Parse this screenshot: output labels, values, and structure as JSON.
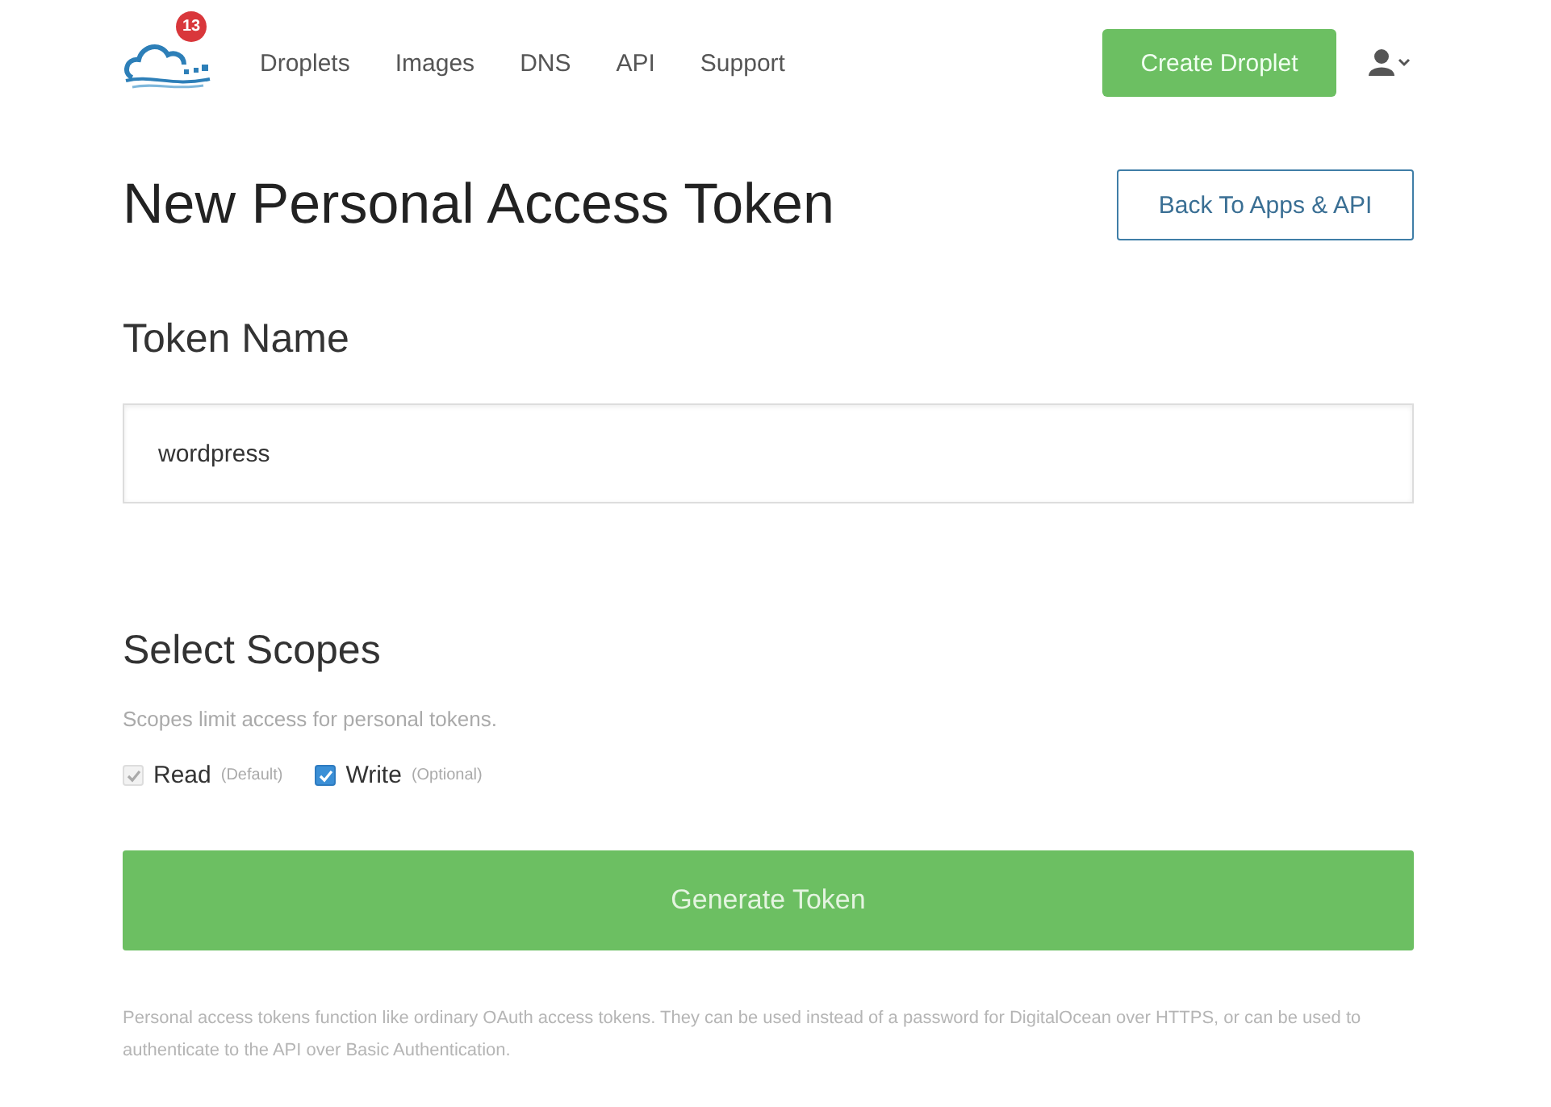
{
  "nav": {
    "badge": "13",
    "links": [
      {
        "label": "Droplets"
      },
      {
        "label": "Images"
      },
      {
        "label": "DNS"
      },
      {
        "label": "API"
      },
      {
        "label": "Support"
      }
    ],
    "create_button": "Create Droplet"
  },
  "page": {
    "title": "New Personal Access Token",
    "back_button": "Back To Apps & API"
  },
  "token_name": {
    "heading": "Token Name",
    "value": "wordpress"
  },
  "scopes": {
    "heading": "Select Scopes",
    "description": "Scopes limit access for personal tokens.",
    "options": [
      {
        "label": "Read",
        "note": "(Default)",
        "checked": true,
        "disabled": true
      },
      {
        "label": "Write",
        "note": "(Optional)",
        "checked": true,
        "disabled": false
      }
    ]
  },
  "generate_button": "Generate Token",
  "footer_note": "Personal access tokens function like ordinary OAuth access tokens. They can be used instead of a password for DigitalOcean over HTTPS, or can be used to authenticate to the API over Basic Authentication."
}
